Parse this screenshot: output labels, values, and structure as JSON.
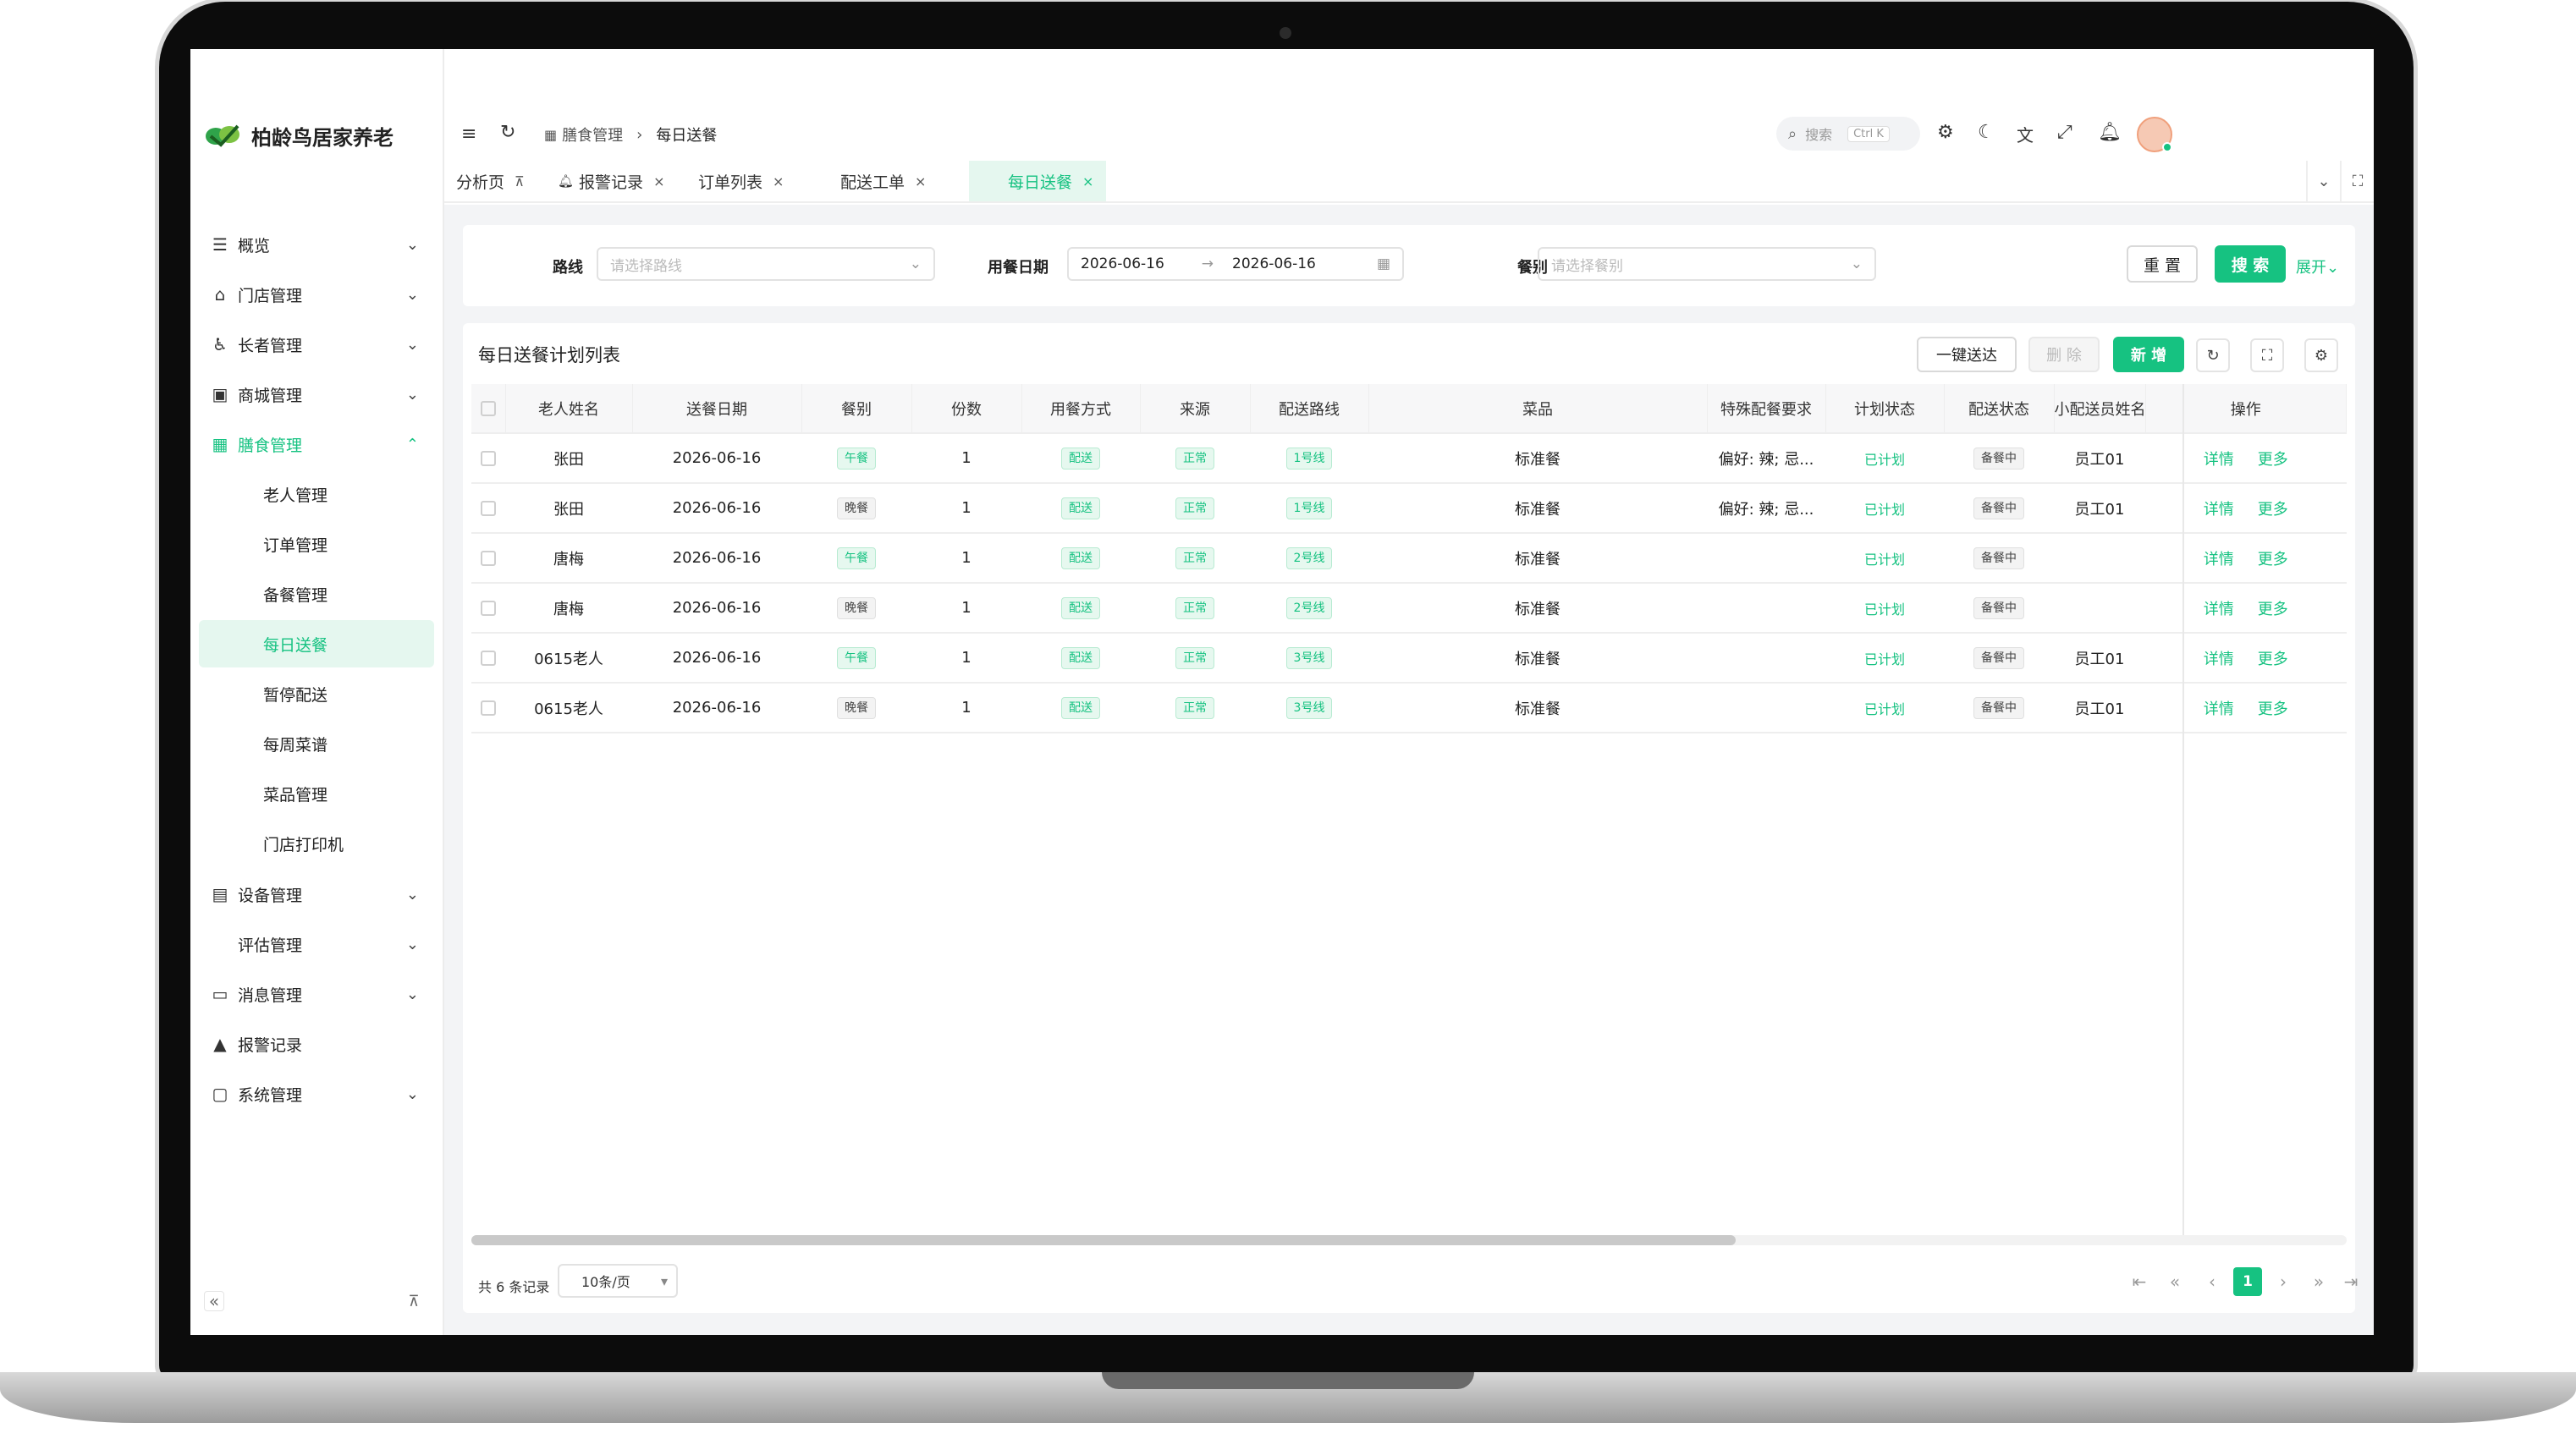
{
  "app": {
    "logo_text": "柏龄鸟居家养老"
  },
  "sidebar": {
    "items": [
      {
        "label": "概览",
        "icon": "list-icon"
      },
      {
        "label": "门店管理",
        "icon": "bank-icon"
      },
      {
        "label": "长者管理",
        "icon": "walker-icon"
      },
      {
        "label": "商城管理",
        "icon": "bag-icon"
      },
      {
        "label": "膳食管理",
        "icon": "calendar-icon"
      }
    ],
    "sub_items": [
      "老人管理",
      "订单管理",
      "备餐管理",
      "每日送餐",
      "暂停配送",
      "每周菜谱",
      "菜品管理",
      "门店打印机"
    ],
    "items_after": [
      {
        "label": "设备管理",
        "icon": "device-icon"
      },
      {
        "label": "评估管理",
        "icon": ""
      },
      {
        "label": "消息管理",
        "icon": "message-icon"
      },
      {
        "label": "报警记录",
        "icon": "alarm-icon"
      },
      {
        "label": "系统管理",
        "icon": "monitor-icon"
      }
    ],
    "collapse_glyph": "«",
    "pin_glyph": "⊼"
  },
  "header": {
    "breadcrumb_parent": "膳食管理",
    "breadcrumb_current": "每日送餐",
    "search_placeholder": "搜索",
    "search_shortcut": "Ctrl K"
  },
  "tabs": [
    {
      "label": "分析页"
    },
    {
      "label": "报警记录"
    },
    {
      "label": "订单列表"
    },
    {
      "label": "配送工单"
    },
    {
      "label": "每日送餐"
    }
  ],
  "filters": {
    "route_label": "路线",
    "route_placeholder": "请选择路线",
    "date_label": "用餐日期",
    "date_start": "2026-06-16",
    "date_end": "2026-06-16",
    "date_sep": "→",
    "meal_label": "餐别",
    "meal_placeholder": "请选择餐别",
    "reset_label": "重 置",
    "search_label": "搜 索",
    "expand_label": "展开"
  },
  "table": {
    "title": "每日送餐计划列表",
    "btn_send_all": "一键送达",
    "btn_delete": "删 除",
    "btn_add": "新 增",
    "columns": [
      "老人姓名",
      "送餐日期",
      "餐别",
      "份数",
      "用餐方式",
      "来源",
      "配送路线",
      "菜品",
      "特殊配餐要求",
      "计划状态",
      "配送状态",
      "小配送员姓名",
      "操作"
    ],
    "rows": [
      {
        "name": "张田",
        "date": "2026-06-16",
        "meal": "午餐",
        "meal_style": "g",
        "qty": "1",
        "mode": "配送",
        "source": "正常",
        "route": "1号线",
        "dish": "标准餐",
        "special": "偏好: 辣; 忌...",
        "plan": "已计划",
        "delivery": "备餐中",
        "courier": "员工01",
        "op1": "详情",
        "op2": "更多"
      },
      {
        "name": "张田",
        "date": "2026-06-16",
        "meal": "晚餐",
        "meal_style": "gr",
        "qty": "1",
        "mode": "配送",
        "source": "正常",
        "route": "1号线",
        "dish": "标准餐",
        "special": "偏好: 辣; 忌...",
        "plan": "已计划",
        "delivery": "备餐中",
        "courier": "员工01",
        "op1": "详情",
        "op2": "更多"
      },
      {
        "name": "唐梅",
        "date": "2026-06-16",
        "meal": "午餐",
        "meal_style": "g",
        "qty": "1",
        "mode": "配送",
        "source": "正常",
        "route": "2号线",
        "dish": "标准餐",
        "special": "",
        "plan": "已计划",
        "delivery": "备餐中",
        "courier": "",
        "op1": "详情",
        "op2": "更多"
      },
      {
        "name": "唐梅",
        "date": "2026-06-16",
        "meal": "晚餐",
        "meal_style": "gr",
        "qty": "1",
        "mode": "配送",
        "source": "正常",
        "route": "2号线",
        "dish": "标准餐",
        "special": "",
        "plan": "已计划",
        "delivery": "备餐中",
        "courier": "",
        "op1": "详情",
        "op2": "更多"
      },
      {
        "name": "0615老人",
        "date": "2026-06-16",
        "meal": "午餐",
        "meal_style": "g",
        "qty": "1",
        "mode": "配送",
        "source": "正常",
        "route": "3号线",
        "dish": "标准餐",
        "special": "",
        "plan": "已计划",
        "delivery": "备餐中",
        "courier": "员工01",
        "op1": "详情",
        "op2": "更多"
      },
      {
        "name": "0615老人",
        "date": "2026-06-16",
        "meal": "晚餐",
        "meal_style": "gr",
        "qty": "1",
        "mode": "配送",
        "source": "正常",
        "route": "3号线",
        "dish": "标准餐",
        "special": "",
        "plan": "已计划",
        "delivery": "备餐中",
        "courier": "员工01",
        "op1": "详情",
        "op2": "更多"
      }
    ]
  },
  "pagination": {
    "total_text": "共 6 条记录",
    "page_size": "10条/页",
    "current_page": "1"
  },
  "colors": {
    "accent": "#16c281",
    "accent_light": "#e5f7ef"
  }
}
